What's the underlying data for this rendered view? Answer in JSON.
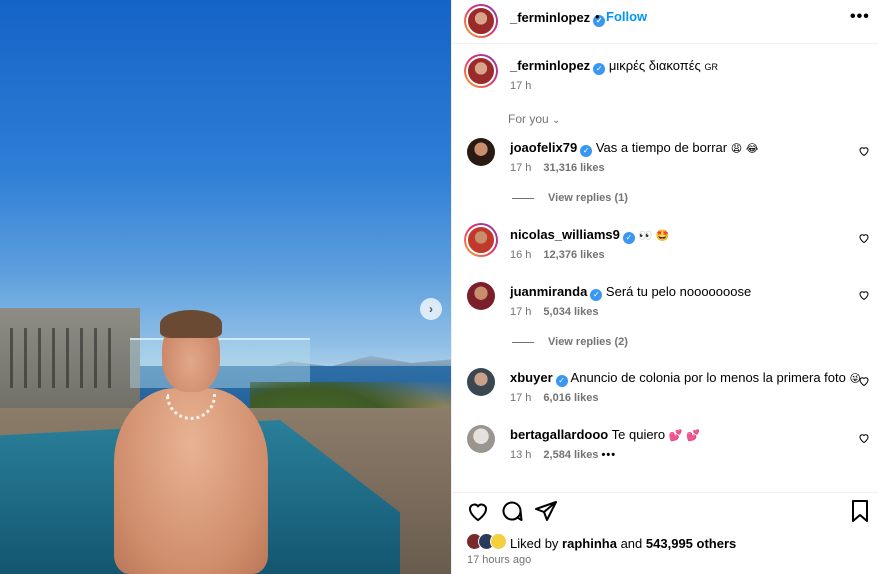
{
  "post": {
    "author": "_ferminlopez",
    "follow_label": "Follow",
    "dot": "•",
    "more_label": "•••",
    "caption": "μικρές διακοπές",
    "caption_flag": "GR",
    "caption_time": "17 h",
    "sort_label": "For you",
    "next_arrow": "›"
  },
  "comments": [
    {
      "user": "joaofelix79",
      "text": "Vas a tiempo de borrar",
      "emoji": "😩 😂",
      "time": "17 h",
      "likes": "31,316 likes",
      "replies": "View replies (1)"
    },
    {
      "user": "nicolas_williams9",
      "text": "",
      "emoji": "👀 🤩",
      "time": "16 h",
      "likes": "12,376 likes",
      "replies": ""
    },
    {
      "user": "juanmiranda",
      "text": "Será tu pelo nooooooose",
      "emoji": "",
      "time": "17 h",
      "likes": "5,034 likes",
      "replies": "View replies (2)"
    },
    {
      "user": "xbuyer",
      "text": "Anuncio de colonia por lo menos la primera foto",
      "emoji": "😜",
      "time": "17 h",
      "likes": "6,016 likes",
      "replies": ""
    },
    {
      "user": "bertagallardooo",
      "text": "Te quiero",
      "emoji": "💕 💕",
      "time": "13 h",
      "likes": "2,584 likes",
      "replies": "",
      "more": "•••"
    }
  ],
  "footer": {
    "liked_prefix": "Liked by",
    "liked_user": "raphinha",
    "liked_and": "and",
    "liked_others": "543,995 others",
    "time_ago": "17 hours ago"
  },
  "colors": {
    "accent": "#0095f6",
    "verified": "#3897f0",
    "muted": "#737373"
  }
}
